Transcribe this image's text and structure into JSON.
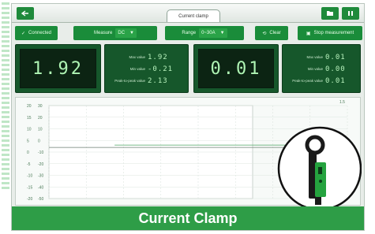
{
  "window": {
    "tab_title": "Current clamp"
  },
  "toolbar": {
    "connected_label": "Connected",
    "measure_label": "Measure",
    "measure_value": "DC",
    "range_label": "Range",
    "range_value": "0~30A",
    "clear_label": "Clear",
    "stop_label": "Stop measurement"
  },
  "meter1": {
    "value": "1.92",
    "max_label": "Max value",
    "max_value": "1.92",
    "min_label": "Min value",
    "min_value": "-0.21",
    "p2p_label": "Peak-to-peak value",
    "p2p_value": "2.13"
  },
  "meter2": {
    "value": "0.01",
    "max_label": "Max value",
    "max_value": "0.01",
    "min_label": "Min value",
    "min_value": "0.00",
    "p2p_label": "Peak-to-peak value",
    "p2p_value": "0.01"
  },
  "chart_data": {
    "type": "line",
    "y_left_ticks": [
      "20",
      "15",
      "10",
      "5",
      "0",
      "-5",
      "-10",
      "-15",
      "-20"
    ],
    "y_right_ticks": [
      "30",
      "20",
      "10",
      "0",
      "-10",
      "-20",
      "-30",
      "-40",
      "-50"
    ],
    "corner_label": "1.5",
    "ylim": [
      -20,
      20
    ],
    "series": [
      {
        "values": [
          2,
          2,
          2,
          2,
          2
        ],
        "x": [
          0.0,
          0.2,
          0.4,
          0.6,
          0.8
        ]
      },
      {
        "values": [
          3,
          3,
          3,
          3
        ],
        "x": [
          0.22,
          0.4,
          0.6,
          0.8
        ]
      }
    ]
  },
  "banner": {
    "text": "Current Clamp"
  },
  "colors": {
    "accent": "#1f8a3b",
    "meter_bg": "#16572b",
    "digit": "#aff5b4",
    "banner": "#2e9d47"
  }
}
